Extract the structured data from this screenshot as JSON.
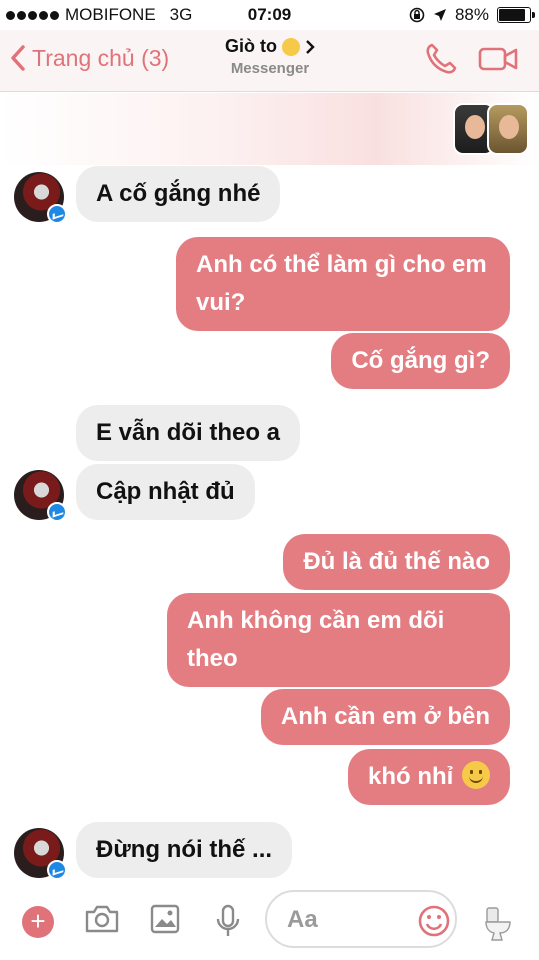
{
  "status": {
    "carrier": "MOBIFONE",
    "network": "3G",
    "time": "07:09",
    "battery": "88%",
    "battery_level": 0.88
  },
  "header": {
    "back_label": "Trang chủ (3)",
    "title": "Giò to",
    "subtitle": "Messenger",
    "accent": "#e0737a"
  },
  "messages": [
    {
      "dir": "in",
      "text": "A cố gắng nhé"
    },
    {
      "dir": "out",
      "text": "Anh có thể làm gì cho em vui?"
    },
    {
      "dir": "out",
      "text": "Cố gắng gì?"
    },
    {
      "dir": "in",
      "text": "E vẫn dõi theo a"
    },
    {
      "dir": "in",
      "text": "Cập nhật đủ"
    },
    {
      "dir": "out",
      "text": "Đủ là đủ thế nào"
    },
    {
      "dir": "out",
      "text": "Anh không cần em dõi theo"
    },
    {
      "dir": "out",
      "text": "Anh cần em ở bên"
    },
    {
      "dir": "out",
      "text": "khó nhỉ"
    },
    {
      "dir": "in",
      "text": "Đừng nói thế ..."
    }
  ],
  "composer": {
    "placeholder": "Aa"
  }
}
